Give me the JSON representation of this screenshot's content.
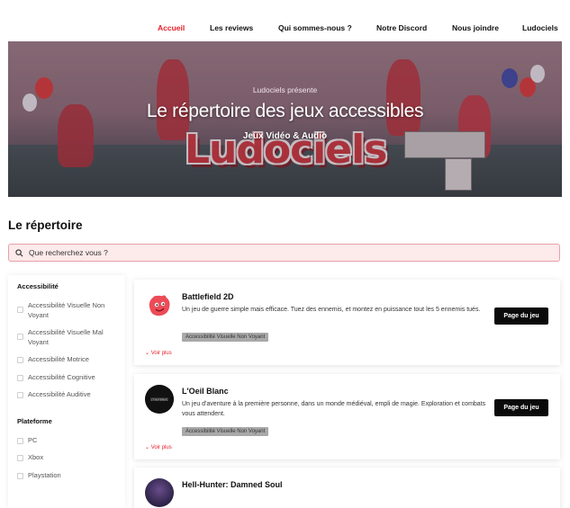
{
  "nav": {
    "items": [
      "Accueil",
      "Les reviews",
      "Qui sommes-nous ?",
      "Notre Discord",
      "Nous joindre",
      "Ludociels"
    ],
    "active_index": 0
  },
  "hero": {
    "kicker": "Ludociels présente",
    "title": "Le répertoire des jeux accessibles",
    "subtitle": "Jeux Vidéo & Audio",
    "logo_text": "Ludociels"
  },
  "directory": {
    "title": "Le répertoire",
    "search_placeholder": "Que recherchez vous ?"
  },
  "filters": {
    "accessibility_title": "Accessibilité",
    "accessibility": [
      "Accessibilité Visuelle Non Voyant",
      "Accessibilité Visuelle Mal Voyant",
      "Accessibilité Motrice",
      "Accessibilité Cognitive",
      "Accessibilité Auditive"
    ],
    "platform_title": "Plateforme",
    "platforms": [
      "PC",
      "Xbox",
      "Playstation"
    ]
  },
  "games": [
    {
      "title": "Battlefield 2D",
      "description": "Un jeu de guerre simple mais efficace. Tuez des ennemis, et montez en puissance tout les 5 ennemis tués.",
      "tag": "Accessibilité Visuelle Non Voyant",
      "button": "Page du jeu",
      "more": "⌄ Voir plus"
    },
    {
      "title": "L'Oeil Blanc",
      "description": "Un jeu d'aventure à la première personne, dans un monde médiéval, empli de magie. Exploration et combats vous attendent.",
      "tag": "Accessibilité Visuelle Non Voyant",
      "button": "Page du jeu",
      "more": "⌄ Voir plus",
      "logo_text": "L'Oeil Blanc"
    },
    {
      "title": "Hell-Hunter: Damned Soul"
    }
  ],
  "colors": {
    "accent": "#e8202a",
    "button_bg": "#0a0a0a",
    "tag_bg": "#a9a9a9",
    "search_bg": "#fdeaea",
    "search_border": "#e7a0a6"
  }
}
